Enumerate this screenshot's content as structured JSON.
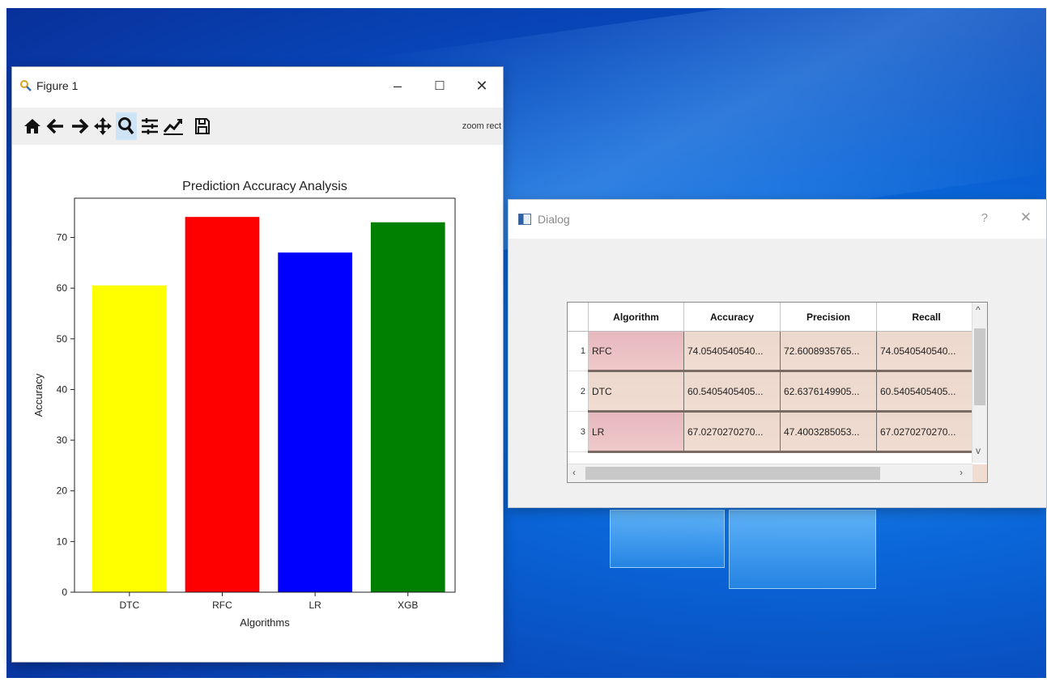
{
  "figure_window": {
    "title": "Figure 1",
    "controls": {
      "minimize": "–",
      "maximize": "☐",
      "close": "✕"
    },
    "toolbar": {
      "tools": [
        {
          "name": "home-icon",
          "glyph": "⌂"
        },
        {
          "name": "back-icon",
          "glyph": "←"
        },
        {
          "name": "forward-icon",
          "glyph": "→"
        },
        {
          "name": "pan-icon",
          "glyph": "✥"
        },
        {
          "name": "zoom-icon",
          "glyph": "🔍"
        },
        {
          "name": "subplots-icon",
          "glyph": "☰"
        },
        {
          "name": "edit-curve-icon",
          "glyph": "📈"
        },
        {
          "name": "save-icon",
          "glyph": "💾"
        }
      ],
      "active_tool": "zoom-icon",
      "status": "zoom rect"
    }
  },
  "chart_data": {
    "type": "bar",
    "title": "Prediction Accuracy Analysis",
    "xlabel": "Algorithms",
    "ylabel": "Accuracy",
    "categories": [
      "DTC",
      "RFC",
      "LR",
      "XGB"
    ],
    "values": [
      60.5405405405,
      74.054054054,
      67.027027027,
      73.0
    ],
    "bar_colors": [
      "#ffff00",
      "#ff0000",
      "#0000ff",
      "#008000"
    ],
    "ylim": [
      0,
      77.75
    ],
    "yticks": [
      0,
      10,
      20,
      30,
      40,
      50,
      60,
      70
    ],
    "grid": false
  },
  "dialog": {
    "title": "Dialog",
    "help": "?",
    "close": "✕",
    "table": {
      "headers": [
        "Algorithm",
        "Accuracy",
        "Precision",
        "Recall"
      ],
      "rows": [
        {
          "num": "1",
          "cells": [
            "RFC",
            "74.0540540540...",
            "72.6008935765...",
            "74.0540540540..."
          ]
        },
        {
          "num": "2",
          "cells": [
            "DTC",
            "60.5405405405...",
            "62.6376149905...",
            "60.5405405405..."
          ]
        },
        {
          "num": "3",
          "cells": [
            "LR",
            "67.0270270270...",
            "47.4003285053...",
            "67.0270270270..."
          ]
        }
      ]
    }
  },
  "colors": {
    "desktop": "#0a66d8",
    "toolbar_bg": "#efefef",
    "active_tool_bg": "#cfe3f7"
  }
}
